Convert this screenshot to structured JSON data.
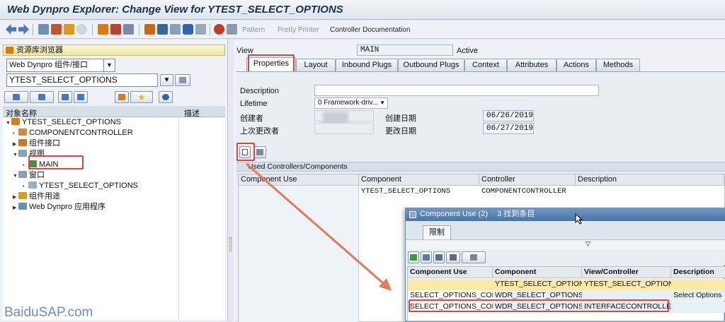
{
  "window_title": "Web Dynpro Explorer: Change View for YTEST_SELECT_OPTIONS",
  "toolbar": {
    "pattern": "Pattern",
    "pretty_printer": "Pretty Printer",
    "controller_doc": "Controller Documentation"
  },
  "left": {
    "panel_title": "资源库浏览器",
    "object_type": "Web Dynpro 组件/接口",
    "object_name": "YTEST_SELECT_OPTIONS",
    "tree_header_name": "对象名称",
    "tree_header_desc": "描述",
    "tree": [
      {
        "label": "YTEST_SELECT_OPTIONS",
        "icon": "component-icon"
      },
      {
        "label": "COMPONENTCONTROLLER",
        "icon": "controller-icon"
      },
      {
        "label": "组件接口",
        "icon": "interface-icon"
      },
      {
        "label": "视图",
        "icon": "views-folder-icon"
      },
      {
        "label": "MAIN",
        "icon": "view-icon"
      },
      {
        "label": "窗口",
        "icon": "windows-folder-icon"
      },
      {
        "label": "YTEST_SELECT_OPTIONS",
        "icon": "window-icon"
      },
      {
        "label": "组件用途",
        "icon": "component-usage-icon"
      },
      {
        "label": "Web Dynpro 应用程序",
        "icon": "application-icon"
      }
    ]
  },
  "view": {
    "label": "View",
    "name": "MAIN",
    "status": "Active"
  },
  "tabs": [
    "Properties",
    "Layout",
    "Inbound Plugs",
    "Outbound Plugs",
    "Context",
    "Attributes",
    "Actions",
    "Methods"
  ],
  "properties": {
    "description_label": "Description",
    "description_value": "",
    "lifetime_label": "Lifetime",
    "lifetime_value": "0 Framework-driv...",
    "created_by_label": "创建者",
    "created_on_label": "创建日期",
    "created_on": "06/26/2019",
    "changed_by_label": "上次更改者",
    "changed_on_label": "更改日期",
    "changed_on": "06/27/2019"
  },
  "used_controllers": {
    "title": "Used Controllers/Components",
    "columns": [
      "Component Use",
      "Component",
      "Controller",
      "Description"
    ],
    "rows": [
      [
        "",
        "YTEST_SELECT_OPTIONS",
        "COMPONENTCONTROLLER",
        ""
      ]
    ]
  },
  "popup": {
    "title": "Component Use (2)",
    "found": "3 找到条目",
    "tab": "限制",
    "columns": [
      "Component Use",
      "Component",
      "View/Controller",
      "Description"
    ],
    "rows": [
      [
        "",
        "YTEST_SELECT_OPTIONS",
        "YTEST_SELECT_OPTIONS",
        ""
      ],
      [
        "SELECT_OPTIONS_COMP",
        "WDR_SELECT_OPTIONS",
        "",
        "Select Options"
      ],
      [
        "SELECT_OPTIONS_COMP",
        "WDR_SELECT_OPTIONS",
        "INTERFACECONTROLLER",
        ""
      ]
    ]
  },
  "watermark": "BaiduSAP.com",
  "colors": {
    "highlight_box": "#e0433f",
    "arrow": "#e8795a",
    "popup_header": "#4a74a8",
    "selected_row": "#fde9a8"
  }
}
